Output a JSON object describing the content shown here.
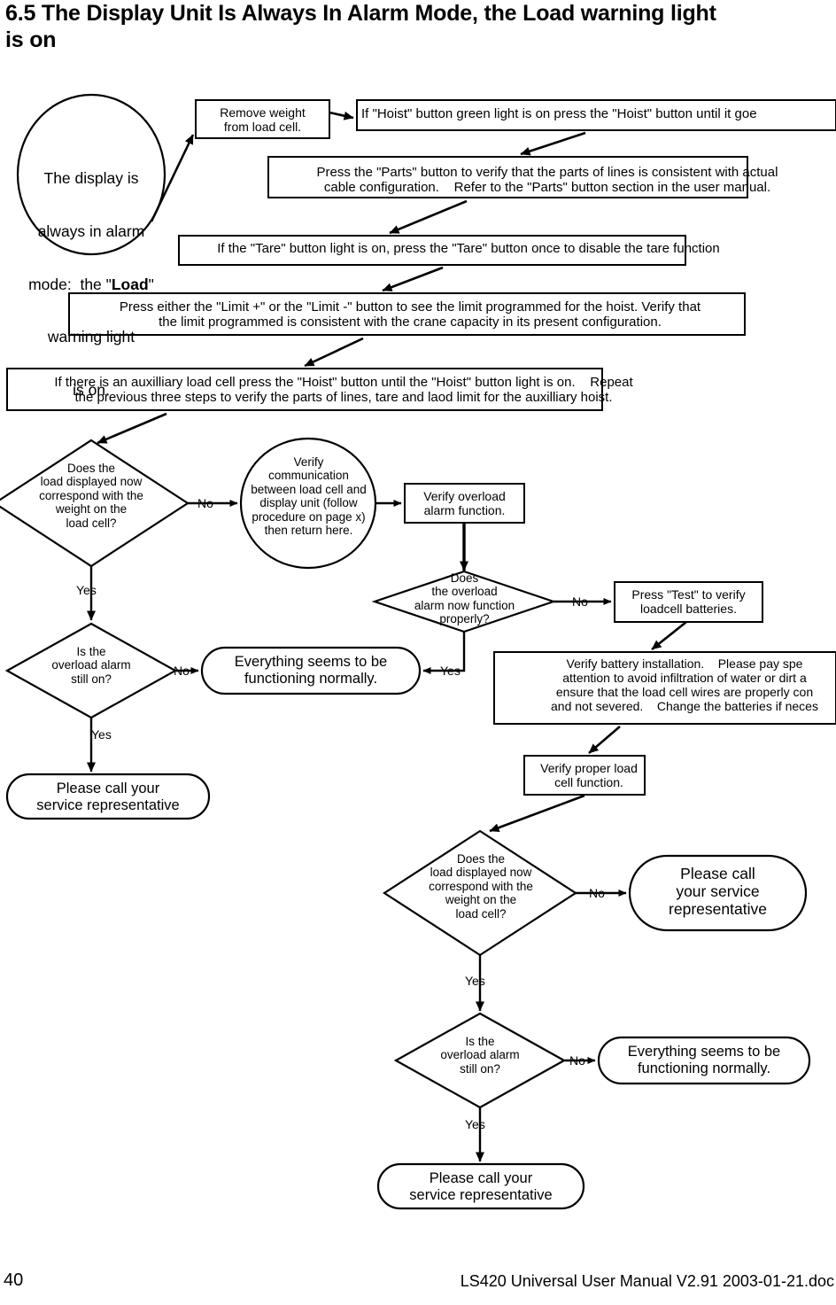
{
  "heading": {
    "number": "6.5",
    "text": "6.5 The Display Unit Is Always In Alarm Mode, the Load warning light\nis on"
  },
  "footer": {
    "page_number": "40",
    "document_reference": "LS420 Universal User Manual V2.91 2003-01-21.doc"
  },
  "flowchart": {
    "type": "flowchart",
    "start": {
      "shape": "circle",
      "line1": "The display is",
      "line2": "always in alarm",
      "line3_pre": "mode:  the \"",
      "line3_bold": "Load",
      "line3_post": "\"",
      "line4": "warning light",
      "line5": "is on."
    },
    "steps": {
      "remove_weight": "Remove weight\nfrom load cell.",
      "hoist_button": "If \"Hoist\" button green light is on press the \"Hoist\" button until it goe",
      "parts_button": "Press the \"Parts\" button to verify that the parts of lines is consistent with actual\ncable configuration.    Refer to the \"Parts\" button section in the user manual.",
      "tare_button": "If the \"Tare\" button light is on, press the \"Tare\" button once to disable the tare function",
      "limit_button": "Press either the \"Limit +\" or the \"Limit -\" button to see the limit programmed for the hoist. Verify that\nthe limit programmed is consistent with the crane capacity in its present configuration.",
      "auxilliary_hoist": "If there is an auxilliary load cell press the \"Hoist\" button until the \"Hoist\" button light is on.    Repeat\nthe previous three steps to verify the parts of lines, tare and laod limit for the auxilliary hoist.",
      "verify_communication": "Verify\ncommunication\nbetween load cell and\ndisplay unit (follow\nprocedure on page x)\nthen return here.",
      "verify_overload_alarm": "Verify overload\nalarm function.",
      "press_test": "Press \"Test\" to verify\nloadcell batteries.",
      "verify_battery": "Verify battery installation.    Please pay spe\nattention to avoid infiltration of water or dirt a\nensure that the load cell wires are properly con\nand not severed.    Change the batteries if neces",
      "verify_load_cell": "Verify proper load\ncell function."
    },
    "decisions": {
      "load_match_top": "Does the\nload displayed now\ncorrespond with the\nweight on the\nload cell?",
      "overload_still_on_top": "Is the\noverload alarm\nstill on?",
      "overload_functions": "Does\nthe overload\nalarm now function\nproperly?",
      "load_match_bottom": "Does the\nload displayed now\ncorrespond with the\nweight on the\nload cell?",
      "overload_still_on_bottom": "Is the\noverload alarm\nstill on?"
    },
    "terminals": {
      "call_service_left": "Please call your\nservice representative",
      "ok_middle": "Everything seems to be\nfunctioning normally.",
      "call_service_right": "Please call\nyour service\nrepresentative",
      "ok_bottom": "Everything seems to be\nfunctioning normally.",
      "call_service_bottom": "Please call your\nservice representative"
    },
    "edge_labels": {
      "no_1": "No",
      "yes_1": "Yes",
      "no_2": "No",
      "yes_2": "Yes",
      "no_3": "No",
      "yes_3": "Yes",
      "no_4": "No",
      "yes_4": "Yes",
      "no_5": "No",
      "yes_5": "Yes"
    }
  }
}
